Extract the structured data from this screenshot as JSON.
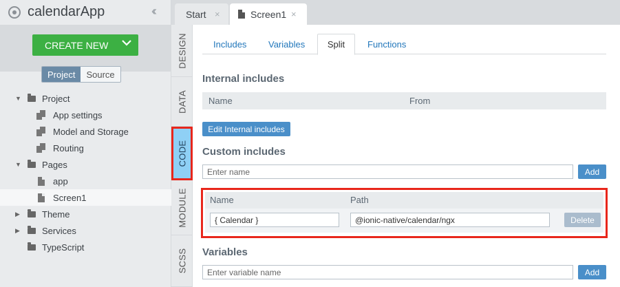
{
  "app": {
    "title": "calendarApp"
  },
  "sidebar": {
    "create_label": "CREATE NEW",
    "toggle": {
      "project": "Project",
      "source": "Source",
      "active": "Project"
    },
    "tree": [
      {
        "label": "Project",
        "type": "folder",
        "expanded": true
      },
      {
        "label": "App settings",
        "type": "files"
      },
      {
        "label": "Model and Storage",
        "type": "files"
      },
      {
        "label": "Routing",
        "type": "files"
      },
      {
        "label": "Pages",
        "type": "folder",
        "expanded": true
      },
      {
        "label": "app",
        "type": "file"
      },
      {
        "label": "Screen1",
        "type": "file",
        "selected": true
      },
      {
        "label": "Theme",
        "type": "folder",
        "expanded": false
      },
      {
        "label": "Services",
        "type": "folder",
        "expanded": false
      },
      {
        "label": "TypeScript",
        "type": "folder",
        "expanded": false
      }
    ]
  },
  "tabs": [
    {
      "label": "Start",
      "close": "×",
      "active": false
    },
    {
      "label": "Screen1",
      "close": "×",
      "active": true
    }
  ],
  "side_tabs": [
    {
      "label": "DESIGN",
      "active": false
    },
    {
      "label": "DATA",
      "active": false
    },
    {
      "label": "CODE",
      "active": true
    },
    {
      "label": "MODULE",
      "active": false
    },
    {
      "label": "SCSS",
      "active": false
    }
  ],
  "subtabs": [
    {
      "label": "Includes",
      "active": false
    },
    {
      "label": "Variables",
      "active": false
    },
    {
      "label": "Split",
      "active": true
    },
    {
      "label": "Functions",
      "active": false
    }
  ],
  "internal_includes": {
    "title": "Internal includes",
    "col_name": "Name",
    "col_from": "From",
    "edit_button": "Edit Internal includes"
  },
  "custom_includes": {
    "title": "Custom includes",
    "name_placeholder": "Enter name",
    "add_button": "Add",
    "col_name": "Name",
    "col_path": "Path",
    "rows": [
      {
        "name": "{ Calendar }",
        "path": "@ionic-native/calendar/ngx",
        "delete_label": "Delete"
      }
    ]
  },
  "variables": {
    "title": "Variables",
    "placeholder": "Enter variable name",
    "add_button": "Add"
  },
  "colors": {
    "accent_green": "#3cb043",
    "accent_blue": "#4a8fc9",
    "highlight_red": "#e8261b",
    "active_side_tab": "#8fd0f5"
  }
}
